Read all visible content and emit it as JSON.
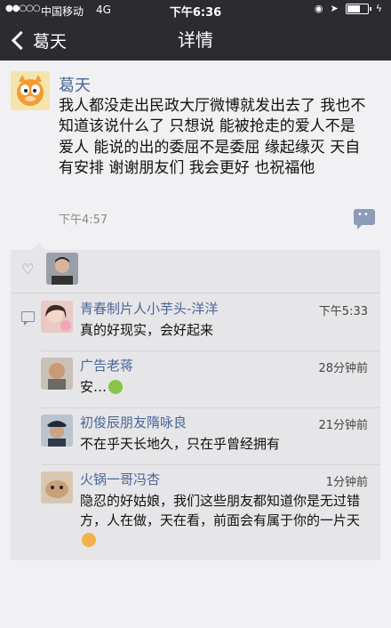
{
  "status_bar": {
    "signal": "●●○○○",
    "carrier": "中国移动",
    "network": "4G",
    "time": "下午6:36",
    "icons": [
      "lock-rotation-icon",
      "location-icon",
      "battery-icon",
      "charging-bolt-icon"
    ]
  },
  "nav": {
    "back_label": "葛天",
    "title": "详情"
  },
  "post": {
    "author": "葛天",
    "text": "我人都没走出民政大厅微博就发出去了 我也不知道该说什么了 只想说 能被抢走的爱人不是爱人 能说的出的委屈不是委屈 缘起缘灭 天自有安排 谢谢朋友们 我会更好 也祝福他",
    "time": "下午4:57"
  },
  "comments": [
    {
      "name": "青春制片人小芋头-洋洋",
      "time": "下午5:33",
      "text": "真的好现实，会好起来"
    },
    {
      "name": "广告老蒋",
      "time": "28分钟前",
      "text": "安…",
      "emoji": "frog-emoji"
    },
    {
      "name": "初俊辰朋友隋咏良",
      "time": "21分钟前",
      "text": "不在乎天长地久，只在乎曾经拥有"
    },
    {
      "name": "火锅一哥冯杏",
      "time": "1分钟前",
      "text": "隐忍的好姑娘，我们这些朋友都知道你是无过错方，人在做，天在看，前面会有属于你的一片天",
      "emoji": "fist-emoji"
    }
  ],
  "colors": {
    "bar": "#2c2c30",
    "name_blue": "#4a6696",
    "panel": "#e6e6e9"
  }
}
